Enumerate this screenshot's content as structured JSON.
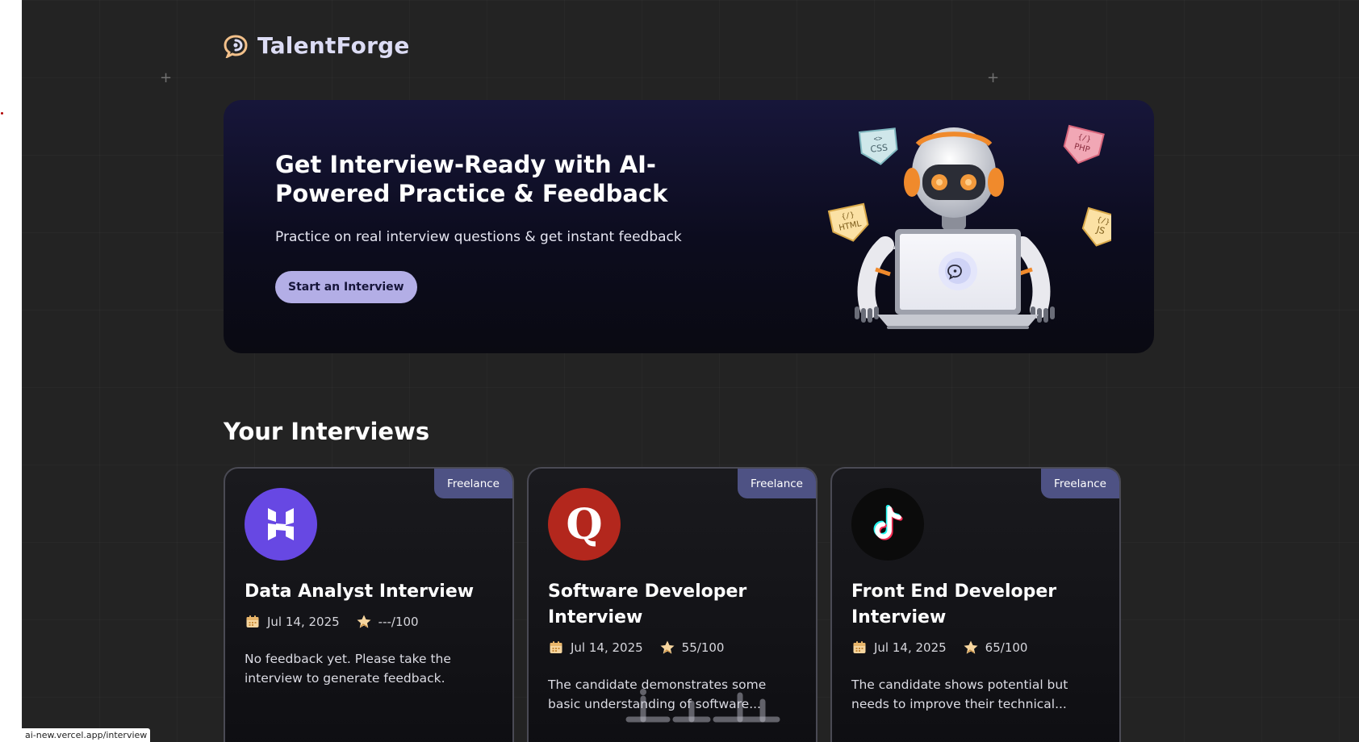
{
  "brand": {
    "name": "TalentForge"
  },
  "hero": {
    "title": "Get Interview-Ready with AI-Powered Practice & Feedback",
    "subtitle": "Practice on real interview questions & get instant feedback",
    "cta_label": "Start an Interview",
    "tech_tags": [
      "CSS",
      "PHP",
      "HTML",
      "JS"
    ]
  },
  "interviews": {
    "section_title": "Your Interviews",
    "cards": [
      {
        "badge": "Freelance",
        "company_icon": "hostinger-logo-icon",
        "title": "Data Analyst Interview",
        "date": "Jul 14, 2025",
        "score": "---/100",
        "description": "No feedback yet. Please take the interview to generate feedback."
      },
      {
        "badge": "Freelance",
        "company_icon": "quora-logo-icon",
        "logo_letter": "Q",
        "title": "Software Developer Interview",
        "date": "Jul 14, 2025",
        "score": "55/100",
        "description": "The candidate demonstrates some basic understanding of software..."
      },
      {
        "badge": "Freelance",
        "company_icon": "tiktok-logo-icon",
        "title": "Front End Developer Interview",
        "date": "Jul 14, 2025",
        "score": "65/100",
        "description": "The candidate shows potential but needs to improve their technical..."
      }
    ]
  },
  "status_bar": {
    "url": "ai-new.vercel.app/interview"
  },
  "colors": {
    "background": "#232323",
    "accent": "#b3aee6",
    "badge": "#4e5284",
    "brand_text": "#dcdcf4"
  }
}
